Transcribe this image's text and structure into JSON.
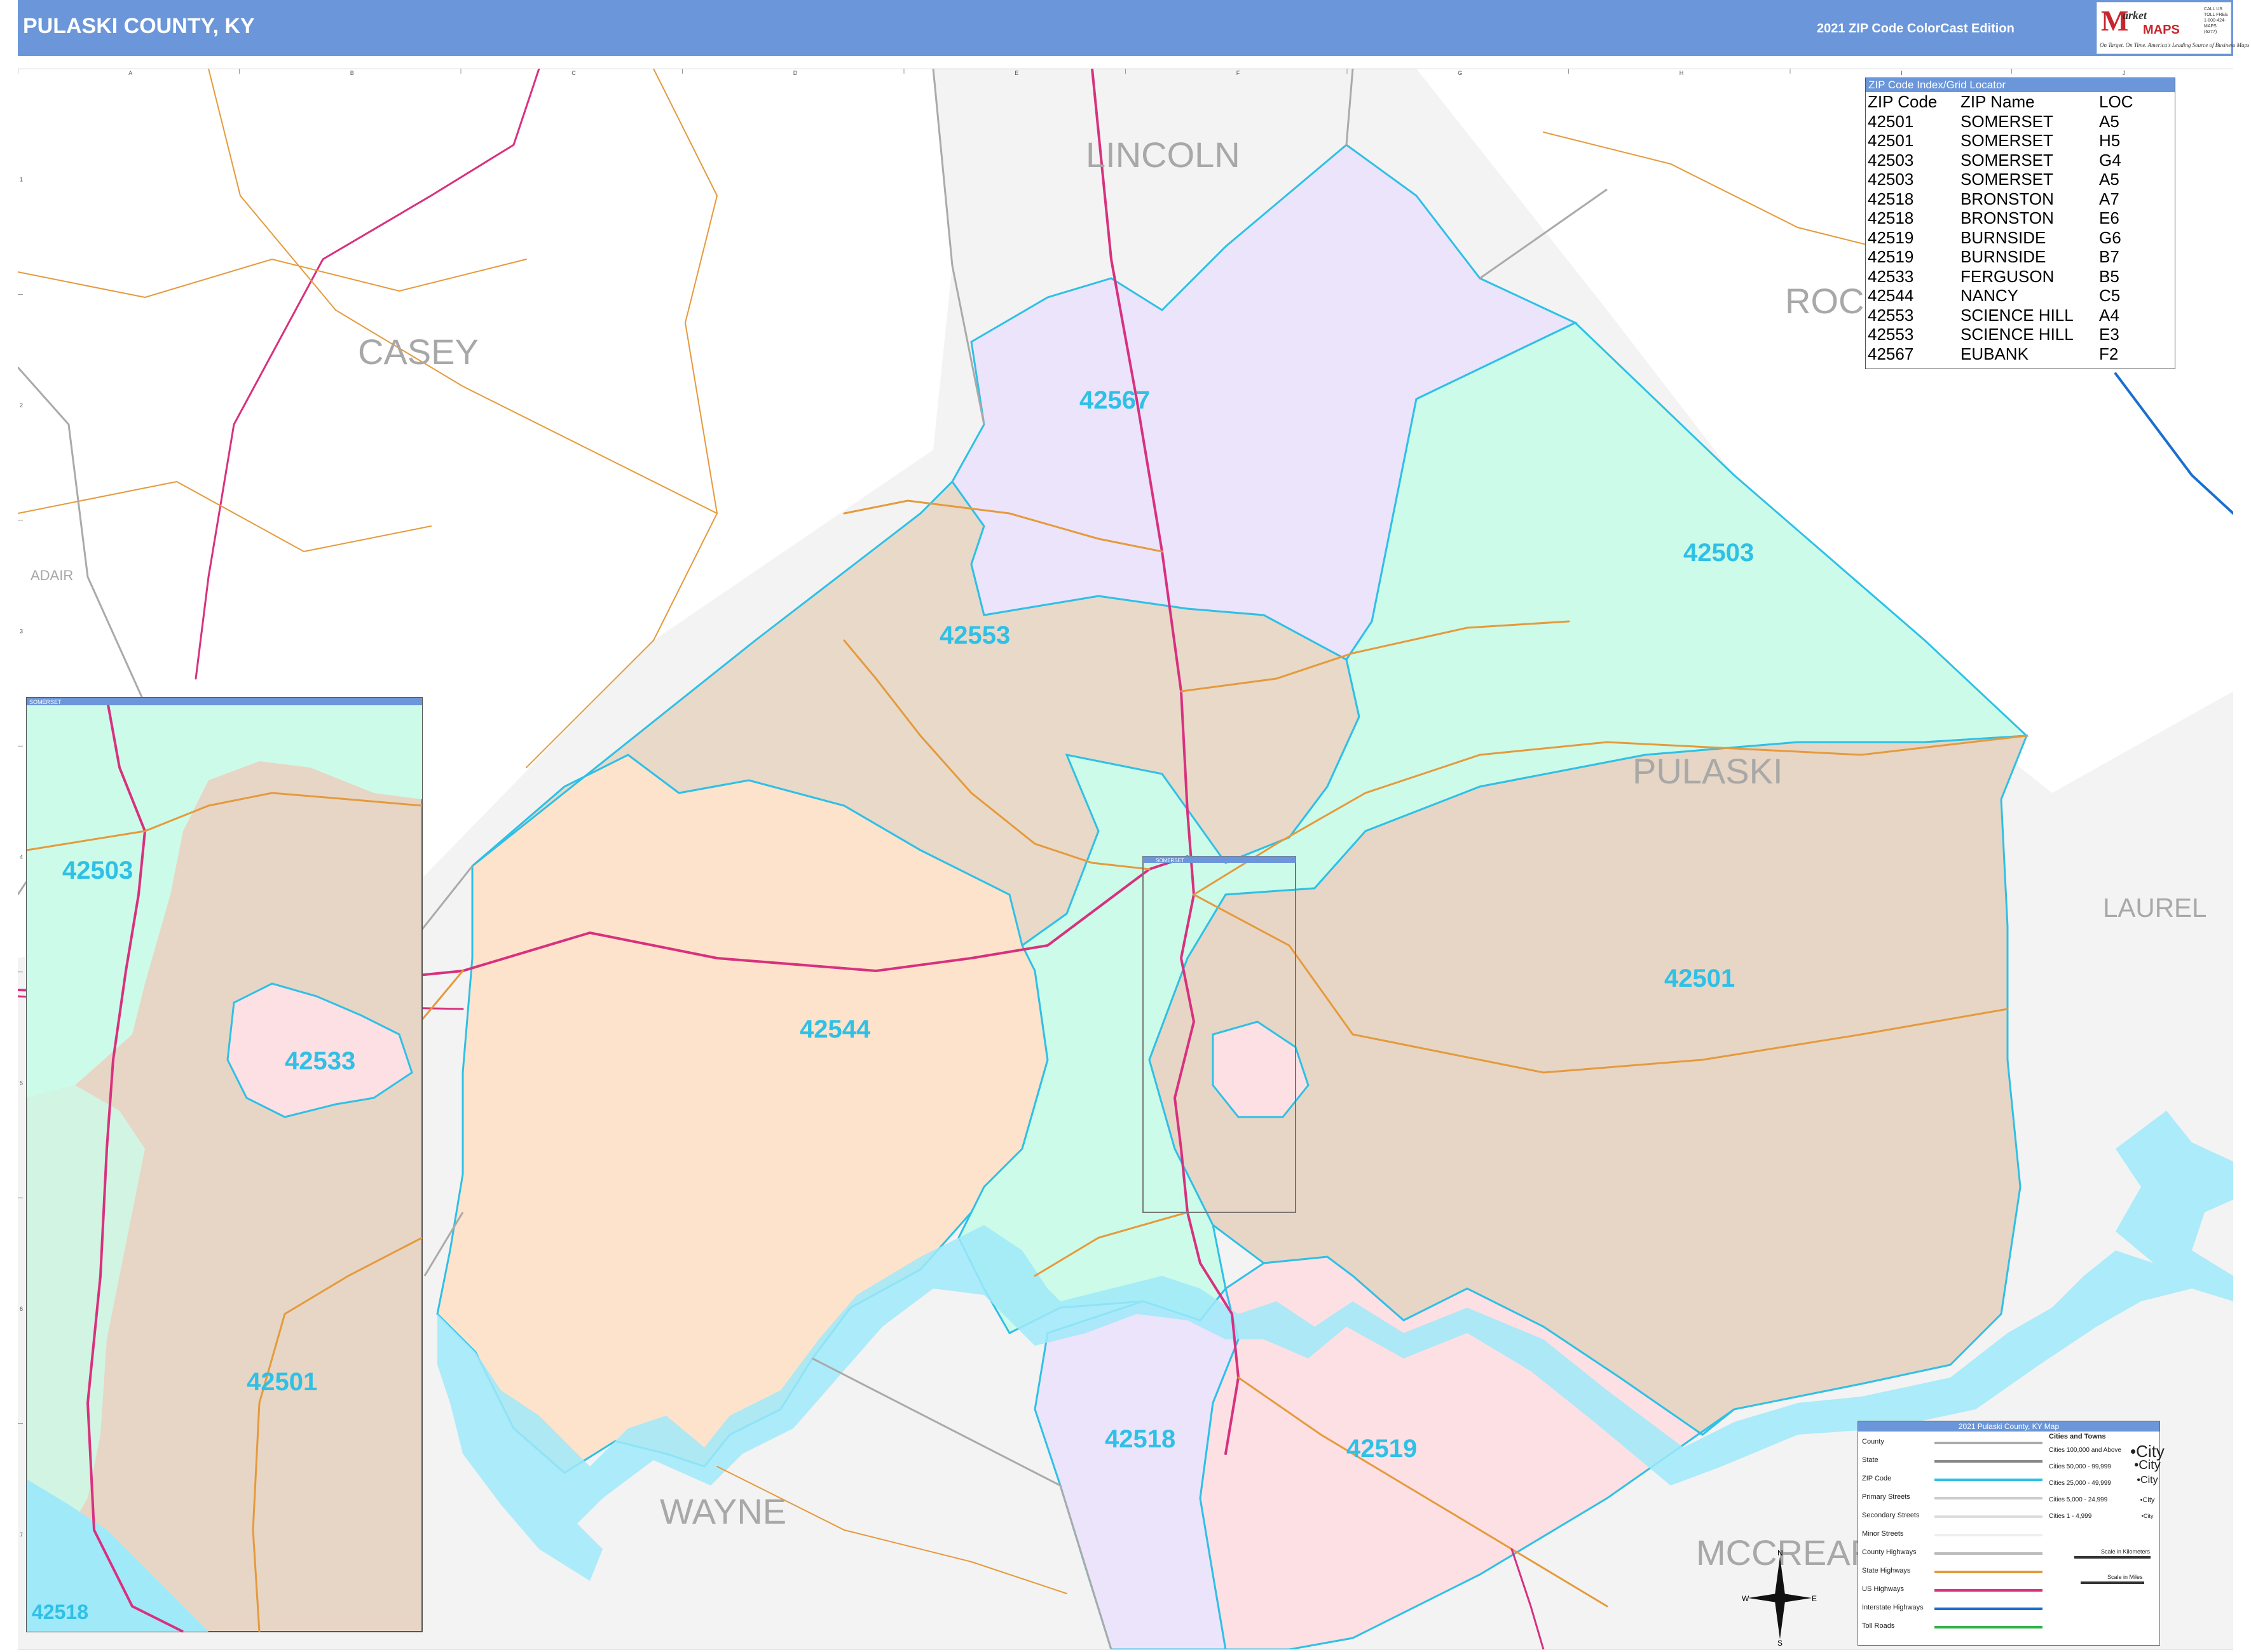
{
  "header": {
    "title": "PULASKI COUNTY, KY",
    "edition": "2021 ZIP Code ColorCast Edition",
    "logo": {
      "brand": "Market MAPS",
      "tagline": "On Target. On Time. America's Leading Source of Business Maps",
      "contact": "CALL US TOLL FREE 1-800-424-MAPS (6277)"
    }
  },
  "grid": {
    "columns": [
      "A",
      "B",
      "C",
      "D",
      "E",
      "F",
      "G",
      "H",
      "I",
      "J"
    ],
    "rows": [
      "1",
      "2",
      "3",
      "4",
      "5",
      "6",
      "7"
    ]
  },
  "counties": {
    "lincoln": "LINCOLN",
    "casey": "CASEY",
    "rockcastle": "ROC",
    "adair": "ADAIR",
    "pulaski": "PULASKI",
    "laurel": "LAUREL",
    "wayne": "WAYNE",
    "mccreary": "MCCREAR"
  },
  "zip_labels": {
    "z42567": "42567",
    "z42553": "42553",
    "z42503": "42503",
    "z42544": "42544",
    "z42501": "42501",
    "z42518": "42518",
    "z42519": "42519",
    "inset_42503": "42503",
    "inset_42533": "42533",
    "inset_42501": "42501",
    "inset_42518": "42518"
  },
  "inset": {
    "title": "SOMERSET",
    "outline_title": "SOMERSET"
  },
  "zip_index": {
    "title": "ZIP Code Index/Grid Locator",
    "columns": [
      "ZIP Code",
      "ZIP Name",
      "LOC"
    ],
    "rows": [
      [
        "42501",
        "SOMERSET",
        "A5"
      ],
      [
        "42501",
        "SOMERSET",
        "H5"
      ],
      [
        "42503",
        "SOMERSET",
        "G4"
      ],
      [
        "42503",
        "SOMERSET",
        "A5"
      ],
      [
        "42518",
        "BRONSTON",
        "A7"
      ],
      [
        "42518",
        "BRONSTON",
        "E6"
      ],
      [
        "42519",
        "BURNSIDE",
        "G6"
      ],
      [
        "42519",
        "BURNSIDE",
        "B7"
      ],
      [
        "42533",
        "FERGUSON",
        "B5"
      ],
      [
        "42544",
        "NANCY",
        "C5"
      ],
      [
        "42553",
        "SCIENCE HILL",
        "A4"
      ],
      [
        "42553",
        "SCIENCE HILL",
        "E3"
      ],
      [
        "42567",
        "EUBANK",
        "F2"
      ]
    ]
  },
  "legend": {
    "title": "2021 Pulaski County, KY Map",
    "items": [
      "County",
      "State",
      "ZIP Code",
      "Primary Streets",
      "Secondary Streets",
      "Minor Streets",
      "County Highways",
      "State Highways",
      "US Highways",
      "Interstate Highways",
      "Toll Roads"
    ],
    "cities_title": "Cities and Towns",
    "cities": [
      "Cities 100,000 and Above",
      "Cities 50,000 - 99,999",
      "Cities 25,000 - 49,999",
      "Cities 5,000 - 24,999",
      "Cities 1 - 4,999"
    ],
    "city_samples": [
      "City",
      "City",
      "City",
      "City",
      "City"
    ],
    "scale_km": "Scale in Kilometers",
    "scale_mi": "Scale in Miles"
  },
  "compass": {
    "n": "N",
    "s": "S",
    "e": "E",
    "w": "W"
  },
  "colors": {
    "header": "#6b96d9",
    "zip_outline": "#2fc0e6",
    "zip_42567": "#ebe4fb",
    "zip_42553": "#e8d9c9",
    "zip_42503": "#cdfbe9",
    "zip_42544": "#fde3cc",
    "zip_42501": "#e7d6c5",
    "zip_42518": "#ebe4fb",
    "zip_42519": "#fde0e4",
    "zip_42533": "#fde0e4",
    "water": "#9fe9f9",
    "us_highway": "#d8317f",
    "state_highway": "#e59a3c"
  }
}
